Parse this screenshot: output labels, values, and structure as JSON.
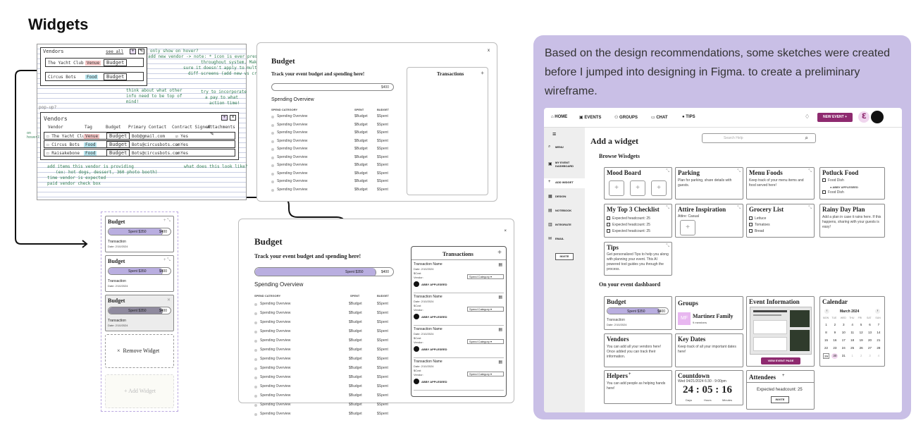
{
  "heading": "Widgets",
  "description": "Based on the design recommendations, some sketches were created before I jumped into designing in Figma. to create a preliminary wireframe.",
  "sketch": {
    "top_title": "Vendors",
    "top_seeall": "see all",
    "top_rows": [
      {
        "name": "The Yacht Club",
        "tag": "Venue",
        "budget": "Budget"
      },
      {
        "name": "Circus Bots",
        "tag": "Food",
        "budget": "Budget"
      }
    ],
    "notes": [
      "only show on hover?",
      "add new vendor -> note: * icon is ever present",
      "throughout system. Make",
      "sure it doesn't apply to multiple",
      "diff screens (add new vs create)?",
      "think about what other",
      "info need to be top of",
      "mind!",
      "try to incorporate",
      "a pay to what",
      "action time!"
    ],
    "popup": "pop-up?",
    "title": "Vendors",
    "cols": [
      "Vendor",
      "Tag",
      "Budget",
      "Primary Contact",
      "Contract Signed",
      "Attachments"
    ],
    "rows": [
      {
        "name": "The Yacht Club",
        "tag": "Venue",
        "budget": "Budget",
        "contact": "Bob@gmail.com",
        "signed": "Yes"
      },
      {
        "name": "Circus Bots",
        "tag": "Food",
        "budget": "Budget",
        "contact": "Bots@circusbots.com",
        "signed": "Yes"
      },
      {
        "name": "Raisakebone",
        "tag": "Food",
        "budget": "Budget",
        "contact": "Bots@circusbots.com",
        "signed": "Yes"
      }
    ],
    "annot": [
      "add items this vendor is providing",
      "(ex: hot dogs, dessert, 360 photo booth)",
      "time vendor is expected",
      "paid vendor check box"
    ],
    "annot2": "what does this look like?",
    "side": "on hover?"
  },
  "budget_small": {
    "title": "Budget",
    "subtitle": "Track your event budget and spending here!",
    "amount": "$400",
    "section": "Spending Overview",
    "cols": [
      "SPEND CATEGORY",
      "SPENT",
      "BUDGET"
    ],
    "rows": [
      "Spending Overview",
      "Spending Overview",
      "Spending Overview",
      "Spending Overview",
      "Spending Overview",
      "Spending Overview",
      "Spending Overview",
      "Spending Overview",
      "Spending Overview",
      "Spending Overview"
    ],
    "spent": "$Budget",
    "budget": "$Spent",
    "transactions": "Transactions",
    "close": "x"
  },
  "budget_cards": {
    "title": "Budget",
    "spent": "Spent $350",
    "total": "$400",
    "txn": "Transaction",
    "date": "Date: 2/10/2024",
    "remove": "Remove Widget",
    "add": "+ Add Widget"
  },
  "budget_big": {
    "title": "Budget",
    "subtitle": "Track your event budget and spending here!",
    "spent": "Spent $350",
    "total": "$400",
    "section": "Spending Overview",
    "cols": [
      "SPEND CATEGORY",
      "SPENT",
      "BUDGET"
    ],
    "rows": [
      "Spending Overview",
      "Spending Overview",
      "Spending Overview",
      "Spending Overview",
      "Spending Overview",
      "Spending Overview",
      "Spending Overview",
      "Spending Overview",
      "Spending Overview",
      "Spending Overview",
      "Spending Overview",
      "Spending Overview",
      "Spending Overview"
    ],
    "spent_val": "$Budget",
    "budget_val": "$Spent",
    "transactions": "Transactions",
    "txn": {
      "name": "Transaction Name",
      "date": "Date: 2/10/2024",
      "cost": "$Cost",
      "vendor": "Vendor:",
      "category": "Spend Category",
      "person": "ABBY APPLESEED"
    }
  },
  "app": {
    "nav": [
      "HOME",
      "EVENTS",
      "GROUPS",
      "CHAT",
      "TIPS"
    ],
    "new_event": "NEW EVENT +",
    "side": [
      "MENU",
      "MY EVENT DASHBOARD",
      "ADD WIDGET",
      "DESIGN",
      "NOTEBOOK",
      "INTEGRATE",
      "EMAIL"
    ],
    "invite": "INVITE",
    "title": "Add a widget",
    "search": "Search Help",
    "browse": "Browse Wisdgets",
    "w_mood": "Mood Board",
    "w_parking": "Parking",
    "w_parking_desc": "Plan for parking, share details with guests.",
    "w_menu": "Menu Foods",
    "w_menu_desc": "Keep track of your menu items and food served here!",
    "w_potluck": "Potluck Food",
    "w_potluck_items": [
      "Food Dish",
      "ABBY APPLESEED",
      "Food Dish"
    ],
    "w_top3": "My Top 3 Checklist",
    "w_top3_items": [
      "Expected headcount: 25",
      "Expected headcount: 25",
      "Expected headcount: 25"
    ],
    "w_attire": "Attire Inspiration",
    "w_attire_desc": "Attire: Casual",
    "w_grocery": "Grocery List",
    "w_grocery_items": [
      "Lettuce",
      "Tomatoes",
      "Bread"
    ],
    "w_rainy": "Rainy Day Plan",
    "w_rainy_desc": "Add a plan in case it rains here. If this happens, sharing with your guests is easy!",
    "w_tips": "Tips",
    "w_tips_desc": "Get personalized Tips to help you along with planning your event. This AI powered tool guides you through the process.",
    "dash": "On your event dashbaord",
    "d_budget": "Budget",
    "d_spent": "Spent $350",
    "d_total": "$400",
    "d_txn": "Transaction",
    "d_date": "Date: 2/10/2024",
    "d_groups": "Groups",
    "d_mf": "MF",
    "d_group_name": "Martinez Family",
    "d_members": "9 members",
    "d_event": "Event Information",
    "d_view": "VIEW EVENT PAGE",
    "d_cal": "Calendar",
    "d_month": "March 2024",
    "d_days": [
      "MON",
      "TUE",
      "WED",
      "THU",
      "FRI",
      "SAT",
      "SUN"
    ],
    "d_dates": [
      "1",
      "2",
      "3",
      "4",
      "5",
      "6",
      "7",
      "8",
      "9",
      "10",
      "11",
      "12",
      "13",
      "14",
      "15",
      "16",
      "17",
      "18",
      "19",
      "20",
      "21",
      "22",
      "23",
      "24",
      "25",
      "26",
      "27",
      "28",
      "29",
      "30",
      "31",
      "1",
      "2",
      "3",
      "4"
    ],
    "d_vendors": "Vendors",
    "d_vendors_desc": "You can add all your vendors here! Once added you can track their information.",
    "d_keydates": "Key Dates",
    "d_keydates_desc": "Keep track of all your important dates here!",
    "d_helpers": "Helpers",
    "d_helpers_desc": "You can add people as helping hands here!",
    "d_count": "Countdown",
    "d_count_date": "Wed 04/21/2024 6:30 - 9:00pm",
    "d_count_val": "24 : 05 : 16",
    "d_count_units": [
      "Days",
      "Hours",
      "Minutes"
    ],
    "d_att": "Attendees",
    "d_att_desc": "Expected headcount: 25",
    "d_att_btn": "INVITE"
  },
  "colors": {
    "purple": "#c9bfe6",
    "spent_fill": "#b9aee0",
    "mf": "#e8b7f0",
    "accent": "#8e2a6f"
  }
}
